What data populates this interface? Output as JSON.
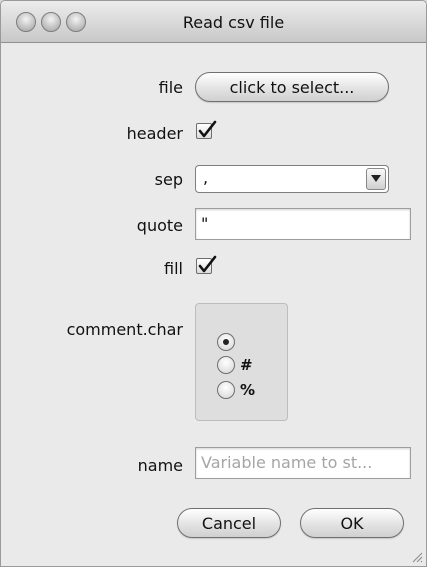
{
  "window": {
    "title": "Read csv file"
  },
  "form": {
    "file": {
      "label": "file",
      "button_label": "click to select..."
    },
    "header": {
      "label": "header",
      "checked": true
    },
    "sep": {
      "label": "sep",
      "selected": ","
    },
    "quote": {
      "label": "quote",
      "value": "\""
    },
    "fill": {
      "label": "fill",
      "checked": true
    },
    "comment_char": {
      "label": "comment.char",
      "options": [
        {
          "label": "",
          "selected": true
        },
        {
          "label": "#",
          "selected": false
        },
        {
          "label": "%",
          "selected": false
        }
      ]
    },
    "name": {
      "label": "name",
      "placeholder": "Variable name to st..."
    }
  },
  "buttons": {
    "cancel_label": "Cancel",
    "ok_label": "OK"
  }
}
